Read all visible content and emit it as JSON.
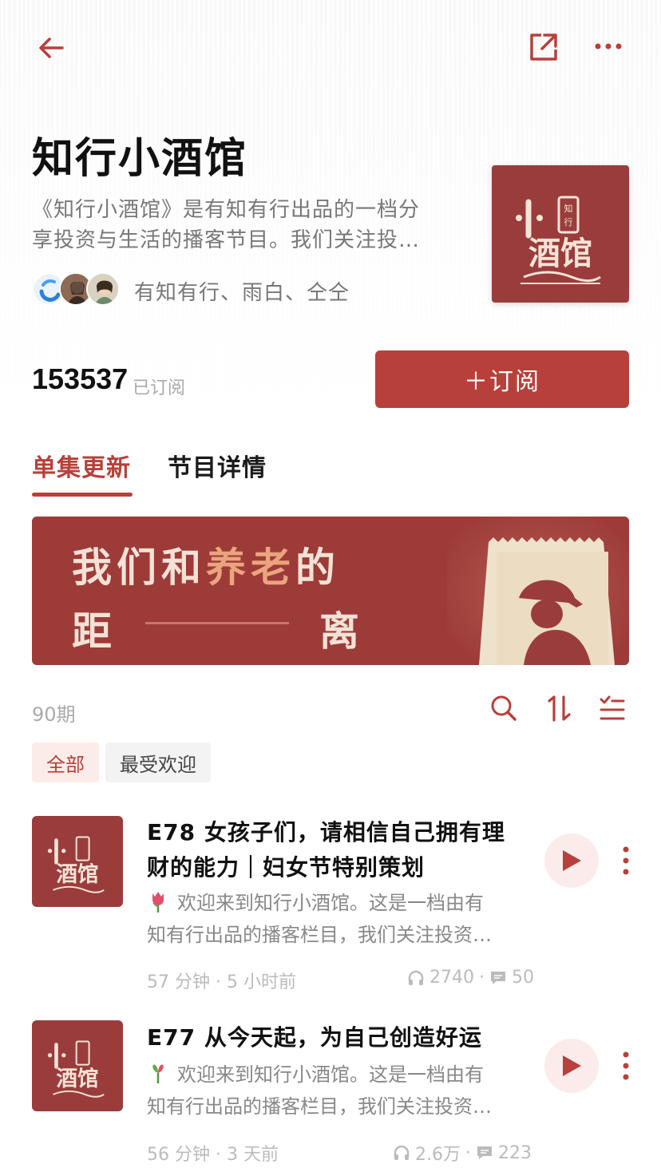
{
  "nav": {
    "back_icon": "back-arrow-icon",
    "share_icon": "share-icon",
    "more_icon": "more-horizontal-icon",
    "accent": "#b8403a"
  },
  "podcast": {
    "title": "知行小酒馆",
    "desc_line1": "《知行小酒馆》是有知有行出品的一档分",
    "desc_line2": "享投资与生活的播客节目。我们关注投…",
    "hosts": "有知有行、雨白、仝仝",
    "cover_text_top": "小",
    "cover_text_tag": "知行",
    "cover_text_main": "酒馆",
    "subscriber_count": "153537",
    "subscriber_label": "已订阅",
    "subscribe_button": "＋订阅"
  },
  "tabs": [
    {
      "label": "单集更新",
      "active": true
    },
    {
      "label": "节目详情",
      "active": false
    }
  ],
  "banner": {
    "line1_a": "我们和",
    "line1_b": "养老",
    "line1_c": "的",
    "line2_a": "距",
    "line2_b": "离"
  },
  "episodes_header": {
    "count": "90期",
    "search_icon": "search-icon",
    "sort_icon": "sort-icon",
    "filter_icon": "list-filter-icon"
  },
  "chips": [
    {
      "label": "全部",
      "active": true
    },
    {
      "label": "最受欢迎",
      "active": false
    }
  ],
  "episodes": [
    {
      "title_line1": "E78 女孩子们，请相信自己拥有理",
      "title_line2": "财的能力｜妇女节特别策划",
      "emoji": "tulip-icon",
      "desc_line1": "欢迎来到知行小酒馆。这是一档由有",
      "desc_line2": "知有行出品的播客栏目，我们关注投资…",
      "duration": "57 分钟",
      "time": "5 小时前",
      "plays": "2740",
      "comments": "50"
    },
    {
      "title_line1": "E77 从今天起，为自己创造好运",
      "title_line2": "",
      "emoji": "clover-icon",
      "desc_line1": "欢迎来到知行小酒馆。这是一档由有",
      "desc_line2": "知有行出品的播客栏目，我们关注投资…",
      "duration": "56 分钟",
      "time": "3 天前",
      "plays": "2.6万",
      "comments": "223"
    }
  ]
}
